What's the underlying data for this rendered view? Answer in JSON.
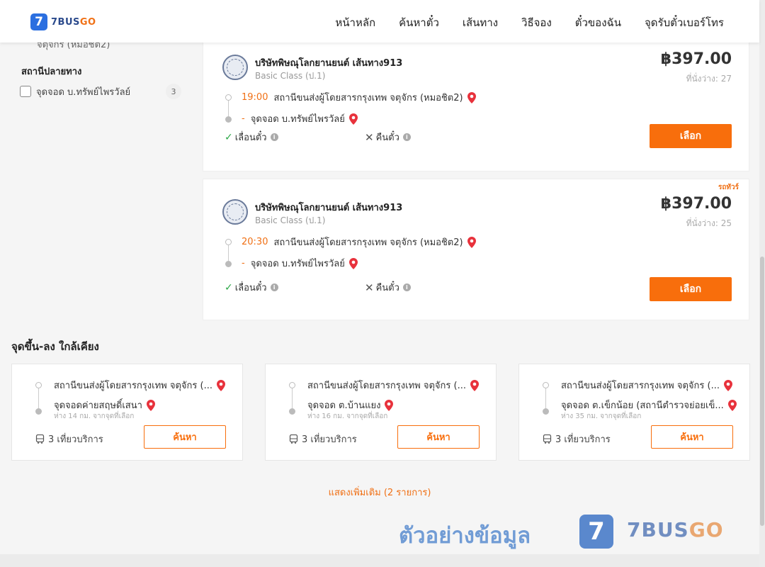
{
  "header": {
    "logo_letter": "7",
    "logo_text_a": "7BUS",
    "logo_text_b": "GO",
    "nav": [
      "หน้าหลัก",
      "ค้นหาตั๋ว",
      "เส้นทาง",
      "วิธีจอง",
      "ตั๋วของฉัน",
      "จุดรับตั๋วเบอร์โทร"
    ]
  },
  "sidebar": {
    "cut_text": "จตุจักร (หมอชิต2)",
    "dest_title": "สถานีปลายทาง",
    "filters": [
      {
        "label": "จุดจอด บ.ทรัพย์ไพรวัลย์",
        "count": "3"
      }
    ]
  },
  "trips": [
    {
      "badge": "",
      "operator": "บริษัทพิษณุโลกยานยนต์ เส้นทาง913",
      "class": "Basic Class (ป.1)",
      "price": "฿397.00",
      "seats": "ที่นั่งว่าง: 27",
      "time": "19:00",
      "from": "สถานีขนส่งผู้โดยสารกรุงเทพ จตุจักร (หมอชิต2)",
      "dash": "-",
      "to": "จุดจอด บ.ทรัพย์ไพรวัลย์",
      "opt_change": "เลื่อนตั๋ว",
      "opt_refund": "คืนตั๋ว",
      "select": "เลือก"
    },
    {
      "badge": "รถทัวร์",
      "operator": "บริษัทพิษณุโลกยานยนต์ เส้นทาง913",
      "class": "Basic Class (ป.1)",
      "price": "฿397.00",
      "seats": "ที่นั่งว่าง: 25",
      "time": "20:30",
      "from": "สถานีขนส่งผู้โดยสารกรุงเทพ จตุจักร (หมอชิต2)",
      "dash": "-",
      "to": "จุดจอด บ.ทรัพย์ไพรวัลย์",
      "opt_change": "เลื่อนตั๋ว",
      "opt_refund": "คืนตั๋ว",
      "select": "เลือก"
    }
  ],
  "nearby": {
    "title": "จุดขึ้น-ลง ใกล้เคียง",
    "cards": [
      {
        "from": "สถานีขนส่งผู้โดยสารกรุงเทพ จตุจักร (...",
        "to": "จุดจอดค่ายสฤษดิ์เสนา",
        "dist": "ห่าง 14 กม. จากจุดที่เลือก",
        "trips": "3 เที่ยวบริการ",
        "button": "ค้นหา"
      },
      {
        "from": "สถานีขนส่งผู้โดยสารกรุงเทพ จตุจักร (...",
        "to": "จุดจอด ต.บ้านแยง",
        "dist": "ห่าง 16 กม. จากจุดที่เลือก",
        "trips": "3 เที่ยวบริการ",
        "button": "ค้นหา"
      },
      {
        "from": "สถานีขนส่งผู้โดยสารกรุงเทพ จตุจักร (...",
        "to": "จุดจอด ต.เข็กน้อย (สถานีตำรวจย่อยเข็...",
        "dist": "ห่าง 35 กม. จากจุดที่เลือก",
        "trips": "3 เที่ยวบริการ",
        "button": "ค้นหา"
      }
    ],
    "more": "แสดงเพิ่มเติม (2 รายการ)"
  },
  "watermark": {
    "text": "ตัวอย่างข้อมูล",
    "logo_letter": "7",
    "brand_a": "7BUS",
    "brand_b": "GO"
  },
  "colors": {
    "accent": "#f86e0c",
    "brand_blue": "#2b6fe0"
  }
}
